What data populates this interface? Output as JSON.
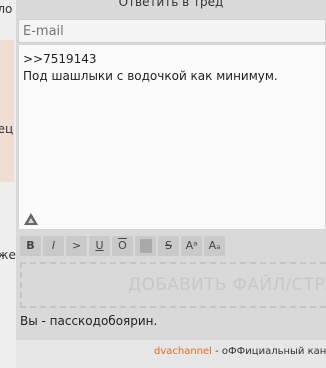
{
  "background": {
    "fragment_top": "оло",
    "fragment_mid": "рец",
    "fragment_bottom": "лже"
  },
  "form": {
    "header": "Ответить в тред",
    "email_placeholder": "E-mail",
    "message_line1": ">>7519143",
    "message_line2": "Под шашлыки с водочкой как минимум.",
    "toolbar": {
      "bold": "B",
      "italic": "I",
      "quote": ">",
      "underline": "U",
      "overline": "O",
      "strike": "S",
      "sup": "Aᵃ",
      "sub": "Aₐ"
    },
    "dropzone_label": "ДОБАВИТЬ ФАЙЛ/СТРАНИЦУ",
    "caption": "Вы - пасскодобоярин.",
    "footer_link": "dvachannel",
    "footer_text": " - оФФициальный канал"
  }
}
